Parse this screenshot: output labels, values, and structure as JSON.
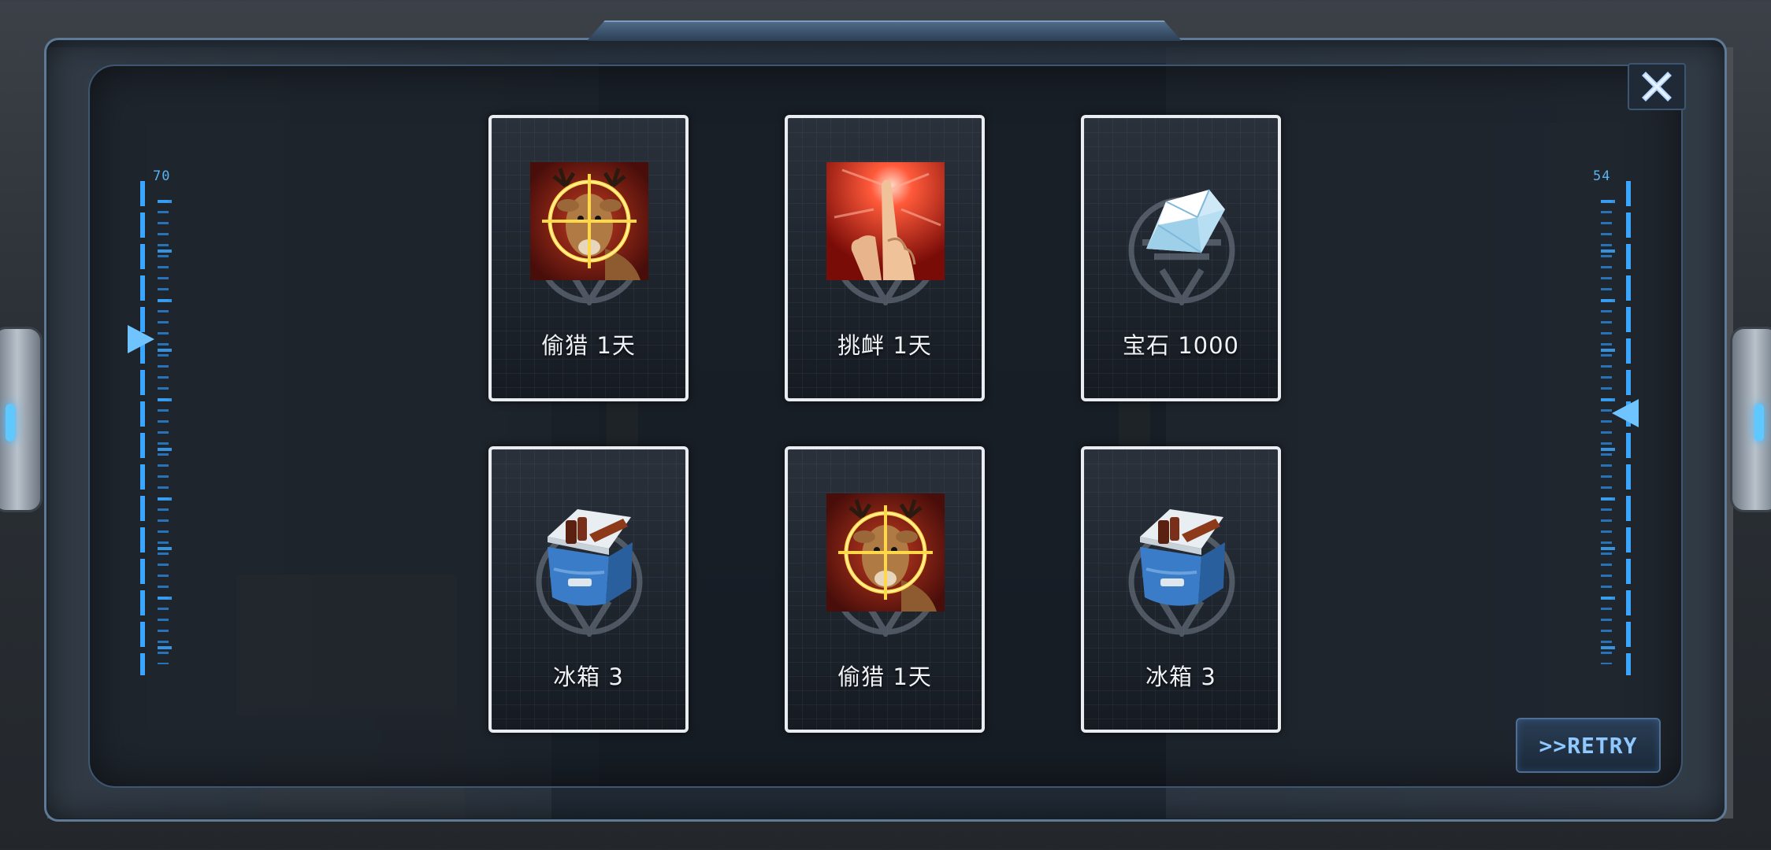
{
  "cards": [
    {
      "label": "偷猎 1天",
      "icon": "deer-crosshair-icon"
    },
    {
      "label": "挑衅 1天",
      "icon": "pointing-finger-icon"
    },
    {
      "label": "宝石 1000",
      "icon": "gem-icon"
    },
    {
      "label": "冰箱 3",
      "icon": "cooler-icon"
    },
    {
      "label": "偷猎 1天",
      "icon": "deer-crosshair-icon"
    },
    {
      "label": "冰箱 3",
      "icon": "cooler-icon"
    }
  ],
  "gauges": {
    "left": {
      "value": "70"
    },
    "right": {
      "value": "54"
    }
  },
  "buttons": {
    "retry": ">>RETRY",
    "close": "close-icon"
  },
  "colors": {
    "accent": "#3aa6ff",
    "card_border": "#e9edf1",
    "frame": "#5f7a96"
  }
}
